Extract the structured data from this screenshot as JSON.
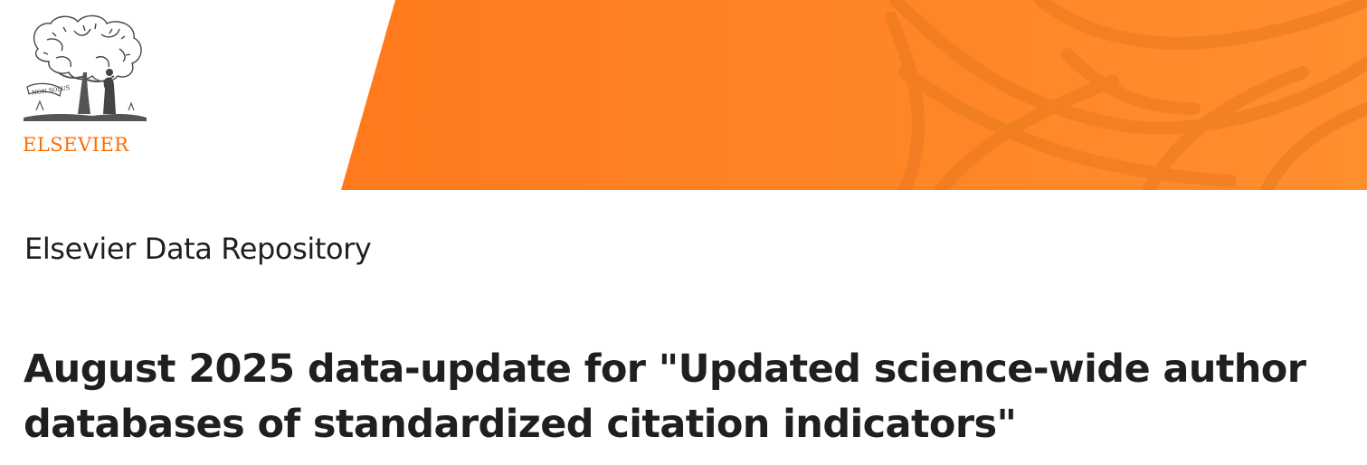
{
  "header": {
    "logo": {
      "wordmark": "ELSEVIER",
      "motto": "NON SOLUS",
      "icon": "elsevier-tree-logo-icon"
    },
    "banner": {
      "icon": "leaf-pattern-icon"
    }
  },
  "breadcrumb": {
    "repository_label": "Elsevier Data Repository"
  },
  "dataset": {
    "title": "August 2025 data-update for \"Updated science-wide author databases of standardized citation indicators\""
  },
  "colors": {
    "brand_orange": "#ff6c00",
    "banner_orange": "#ff7f24",
    "banner_orange_light": "#ff8c2f",
    "text": "#1f1f1f"
  }
}
